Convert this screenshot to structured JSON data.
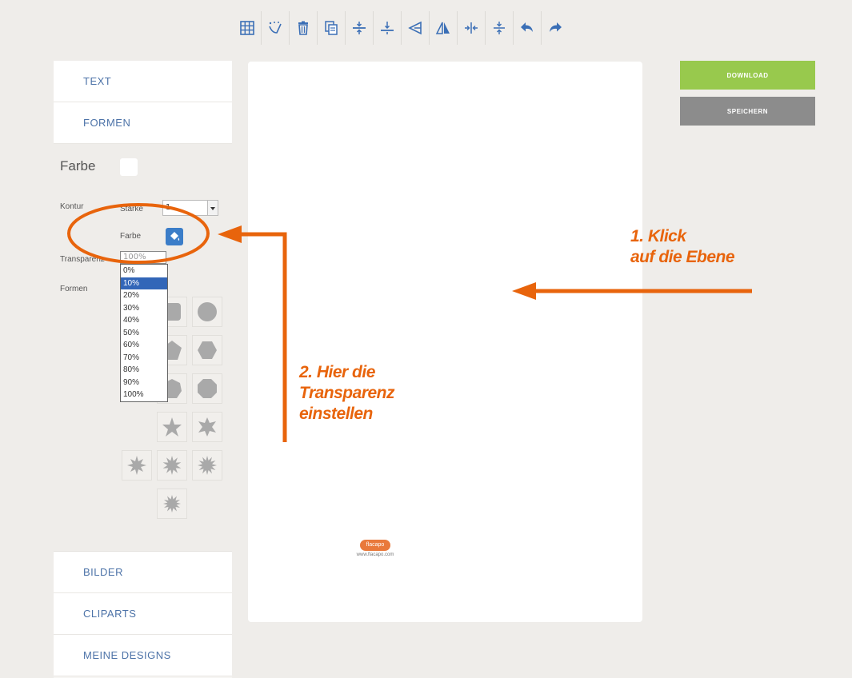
{
  "toolbar": {
    "buttons": [
      {
        "name": "grid-icon"
      },
      {
        "name": "magic-wand-icon"
      },
      {
        "name": "trash-icon"
      },
      {
        "name": "copy-icon"
      },
      {
        "name": "align-top-icon"
      },
      {
        "name": "align-middle-icon"
      },
      {
        "name": "flip-horizontal-icon"
      },
      {
        "name": "flip-vertical-icon"
      },
      {
        "name": "center-horizontal-icon"
      },
      {
        "name": "center-vertical-icon"
      },
      {
        "name": "undo-icon"
      },
      {
        "name": "redo-icon"
      }
    ],
    "icon_color": "#3b6fb6"
  },
  "panel": {
    "text_label": "TEXT",
    "formen_label": "FORMEN",
    "bilder_label": "BILDER",
    "cliparts_label": "CLIPARTS",
    "meine_designs_label": "MEINE DESIGNS",
    "formen": {
      "farbe_title": "Farbe",
      "kontur_label": "Kontur",
      "staerke_label": "Stärke",
      "staerke_value": "1",
      "farbe_label": "Farbe",
      "transparenz_label": "Transparenz",
      "transparenz_value": "100%",
      "formen_label": "Formen",
      "transparency_options": [
        "0%",
        "10%",
        "20%",
        "30%",
        "40%",
        "50%",
        "60%",
        "70%",
        "80%",
        "90%",
        "100%"
      ],
      "selected_option": "10%"
    }
  },
  "canvas": {
    "logo_text": "flacapo",
    "logo_url": "www.flacapo.com"
  },
  "actions": {
    "download_label": "DOWNLOAD",
    "save_label": "SPEICHERN",
    "download_color": "#98c94d",
    "save_color": "#8c8c8c"
  },
  "annotations": {
    "note1_line1": "1. Klick",
    "note1_line2": "auf die Ebene",
    "note2_line1": "2. Hier die",
    "note2_line2": "Transparenz",
    "note2_line3": "einstellen",
    "color": "#e8640c"
  }
}
